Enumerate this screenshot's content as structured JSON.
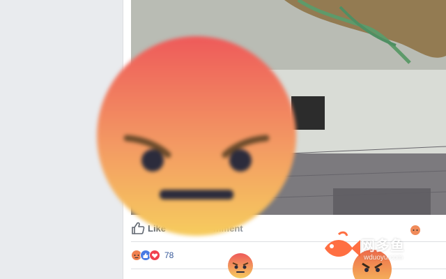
{
  "post": {
    "actions": {
      "like_label": "Like",
      "comment_label": "mment"
    },
    "reactions": {
      "count": "78",
      "icons": [
        "angry-reaction-icon",
        "like-reaction-icon",
        "love-reaction-icon"
      ]
    },
    "photo": {
      "subject": "wall-with-floral-mural-and-vent"
    }
  },
  "overlay": {
    "emoji": "angry-reaction",
    "colors": {
      "top": "#f06b5b",
      "bottom": "#f5c65a"
    }
  },
  "watermark": {
    "title": "网多鱼",
    "subtitle": "wduoyu.com",
    "fish_color": "#ff5722"
  }
}
